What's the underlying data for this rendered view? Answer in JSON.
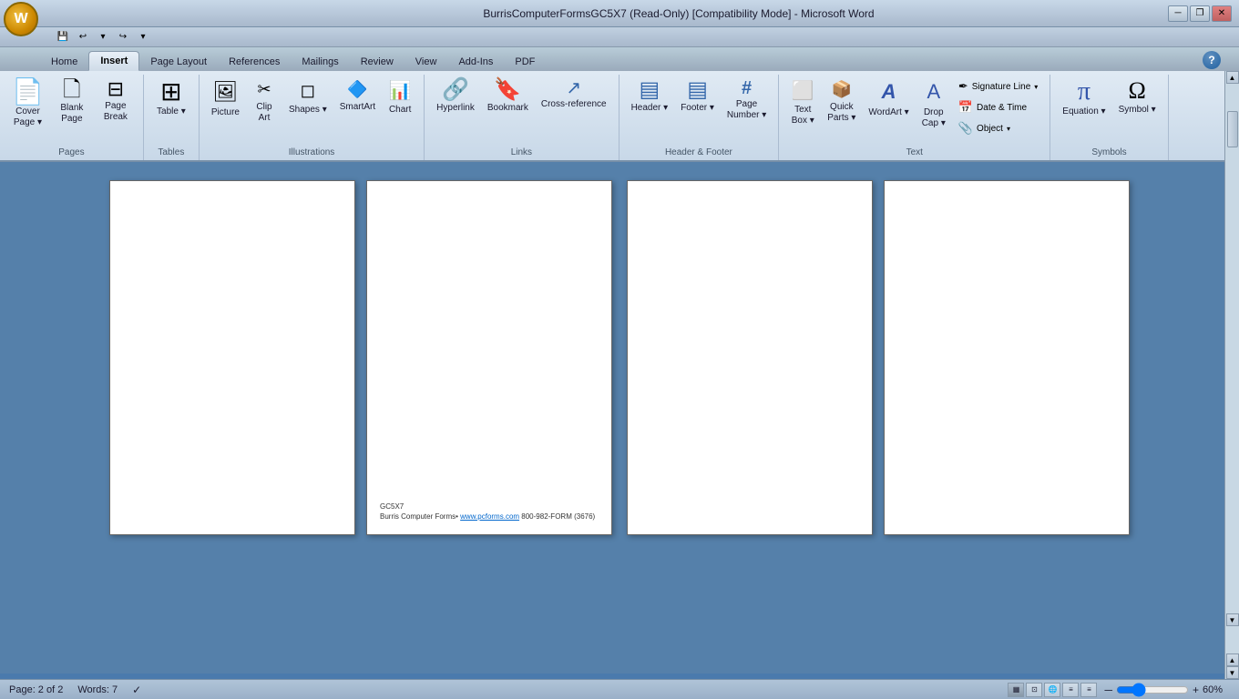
{
  "titlebar": {
    "title": "BurrisComputerFormsGC5X7 (Read-Only) [Compatibility Mode] - Microsoft Word",
    "min": "─",
    "restore": "❐",
    "close": "✕"
  },
  "quickaccess": {
    "save": "💾",
    "undo": "↩",
    "redo": "↪",
    "customizer": "▾"
  },
  "tabs": [
    {
      "id": "home",
      "label": "Home"
    },
    {
      "id": "insert",
      "label": "Insert",
      "active": true
    },
    {
      "id": "pagelayout",
      "label": "Page Layout"
    },
    {
      "id": "references",
      "label": "References"
    },
    {
      "id": "mailings",
      "label": "Mailings"
    },
    {
      "id": "review",
      "label": "Review"
    },
    {
      "id": "view",
      "label": "View"
    },
    {
      "id": "addins",
      "label": "Add-Ins"
    },
    {
      "id": "pdf",
      "label": "PDF"
    }
  ],
  "ribbon": {
    "groups": [
      {
        "id": "pages",
        "label": "Pages",
        "buttons": [
          {
            "id": "cover-page",
            "label": "Cover\nPage",
            "icon": "📄",
            "type": "large",
            "dropdown": true
          },
          {
            "id": "blank-page",
            "label": "Blank\nPage",
            "icon": "📋",
            "type": "large"
          },
          {
            "id": "page-break",
            "label": "Page\nBreak",
            "icon": "⬚",
            "type": "large"
          }
        ]
      },
      {
        "id": "tables",
        "label": "Tables",
        "buttons": [
          {
            "id": "table",
            "label": "Table",
            "icon": "⊞",
            "type": "large",
            "dropdown": true
          }
        ]
      },
      {
        "id": "illustrations",
        "label": "Illustrations",
        "buttons": [
          {
            "id": "picture",
            "label": "Picture",
            "icon": "🖼",
            "type": "medium"
          },
          {
            "id": "clip-art",
            "label": "Clip\nArt",
            "icon": "✂",
            "type": "medium"
          },
          {
            "id": "shapes",
            "label": "Shapes",
            "icon": "◻",
            "type": "medium",
            "dropdown": true
          },
          {
            "id": "smartart",
            "label": "SmartArt",
            "icon": "🔷",
            "type": "medium"
          },
          {
            "id": "chart",
            "label": "Chart",
            "icon": "📊",
            "type": "medium"
          }
        ]
      },
      {
        "id": "links",
        "label": "Links",
        "buttons": [
          {
            "id": "hyperlink",
            "label": "Hyperlink",
            "icon": "🔗",
            "type": "large"
          },
          {
            "id": "bookmark",
            "label": "Bookmark",
            "icon": "🔖",
            "type": "large"
          },
          {
            "id": "cross-reference",
            "label": "Cross-reference",
            "icon": "↗",
            "type": "large"
          }
        ]
      },
      {
        "id": "header-footer",
        "label": "Header & Footer",
        "buttons": [
          {
            "id": "header",
            "label": "Header",
            "icon": "▤",
            "type": "large",
            "dropdown": true
          },
          {
            "id": "footer",
            "label": "Footer",
            "icon": "▤",
            "type": "large",
            "dropdown": true
          },
          {
            "id": "page-number",
            "label": "Page\nNumber",
            "icon": "#",
            "type": "large",
            "dropdown": true
          }
        ]
      },
      {
        "id": "text",
        "label": "Text",
        "buttons": [
          {
            "id": "text-box",
            "label": "Text\nBox",
            "icon": "⬜",
            "type": "medium",
            "dropdown": true
          },
          {
            "id": "quick-parts",
            "label": "Quick\nParts",
            "icon": "📦",
            "type": "medium",
            "dropdown": true
          },
          {
            "id": "wordart",
            "label": "WordArt",
            "icon": "A",
            "type": "medium",
            "dropdown": true
          },
          {
            "id": "drop-cap",
            "label": "Drop\nCap",
            "icon": "A",
            "type": "medium",
            "dropdown": true
          },
          {
            "id": "sig-group",
            "type": "sig-stack",
            "items": [
              {
                "id": "signature-line",
                "label": "Signature Line",
                "icon": "✒",
                "dropdown": true
              },
              {
                "id": "date-time",
                "label": "Date & Time",
                "icon": "📅"
              },
              {
                "id": "object",
                "label": "Object",
                "icon": "📎",
                "dropdown": true
              }
            ]
          }
        ]
      },
      {
        "id": "symbols",
        "label": "Symbols",
        "buttons": [
          {
            "id": "equation",
            "label": "Equation",
            "icon": "π",
            "type": "large",
            "dropdown": true
          },
          {
            "id": "symbol",
            "label": "Symbol",
            "icon": "Ω",
            "type": "large",
            "dropdown": true
          }
        ]
      }
    ]
  },
  "document": {
    "pages": [
      {
        "id": "p1",
        "hasContent": false,
        "hasFooter": false
      },
      {
        "id": "p2",
        "hasContent": false,
        "hasFooter": true,
        "footer": {
          "line1": "GC5X7",
          "line2": "Burris Computer Forms•",
          "link": "www.pcforms.com",
          "line2rest": " 800-982-FORM (3676)"
        }
      },
      {
        "id": "p3",
        "hasContent": false,
        "hasFooter": false
      },
      {
        "id": "p4",
        "hasContent": false,
        "hasFooter": false
      }
    ]
  },
  "statusbar": {
    "page": "Page: 2 of 2",
    "words": "Words: 7",
    "zoom": "60%"
  }
}
